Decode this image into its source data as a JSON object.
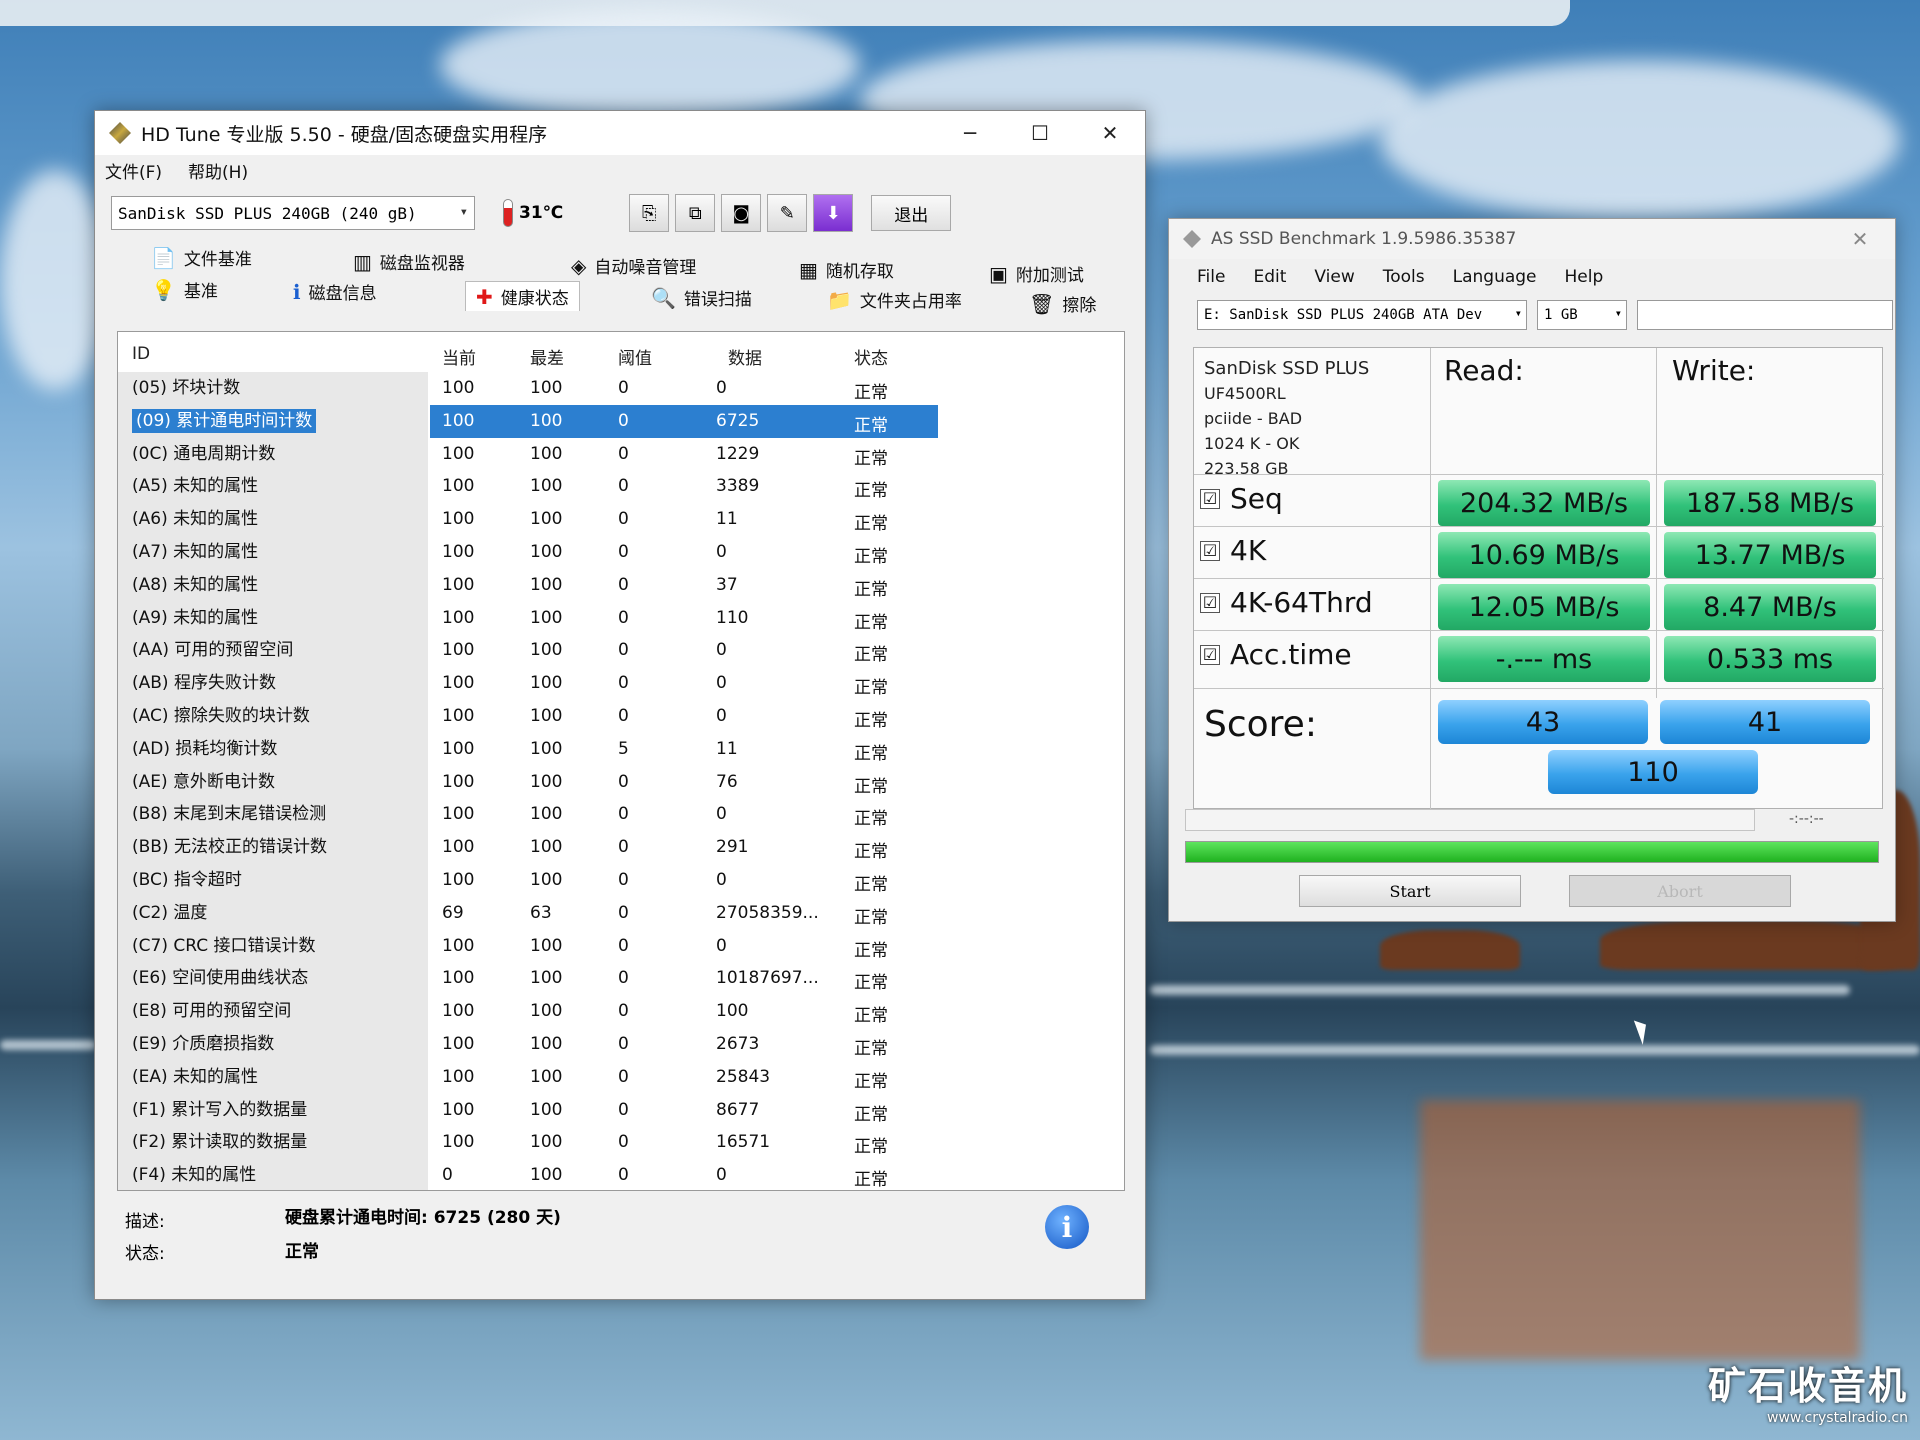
{
  "hdtune": {
    "title": "HD Tune 专业版 5.50 - 硬盘/固态硬盘实用程序",
    "window_controls": [
      "─",
      "☐",
      "✕"
    ],
    "menu": [
      "文件(F)",
      "帮助(H)"
    ],
    "drive": "SanDisk SSD PLUS 240GB (240 gB)",
    "temperature": "31℃",
    "exit_label": "退出",
    "tabs_row1": [
      "文件基准",
      "磁盘监视器",
      "自动噪音管理",
      "随机存取",
      "附加测试"
    ],
    "tabs_row2": [
      "基准",
      "磁盘信息",
      "健康状态",
      "错误扫描",
      "文件夹占用率",
      "擦除"
    ],
    "columns": [
      "ID",
      "当前",
      "最差",
      "阈值",
      "数据",
      "状态"
    ],
    "rows": [
      [
        "(05) 坏块计数",
        "100",
        "100",
        "0",
        "0",
        "正常"
      ],
      [
        "(09) 累计通电时间计数",
        "100",
        "100",
        "0",
        "6725",
        "正常"
      ],
      [
        "(0C) 通电周期计数",
        "100",
        "100",
        "0",
        "1229",
        "正常"
      ],
      [
        "(A5) 未知的属性",
        "100",
        "100",
        "0",
        "3389",
        "正常"
      ],
      [
        "(A6) 未知的属性",
        "100",
        "100",
        "0",
        "11",
        "正常"
      ],
      [
        "(A7) 未知的属性",
        "100",
        "100",
        "0",
        "0",
        "正常"
      ],
      [
        "(A8) 未知的属性",
        "100",
        "100",
        "0",
        "37",
        "正常"
      ],
      [
        "(A9) 未知的属性",
        "100",
        "100",
        "0",
        "110",
        "正常"
      ],
      [
        "(AA) 可用的预留空间",
        "100",
        "100",
        "0",
        "0",
        "正常"
      ],
      [
        "(AB) 程序失败计数",
        "100",
        "100",
        "0",
        "0",
        "正常"
      ],
      [
        "(AC) 擦除失败的块计数",
        "100",
        "100",
        "0",
        "0",
        "正常"
      ],
      [
        "(AD) 损耗均衡计数",
        "100",
        "100",
        "5",
        "11",
        "正常"
      ],
      [
        "(AE) 意外断电计数",
        "100",
        "100",
        "0",
        "76",
        "正常"
      ],
      [
        "(B8) 末尾到末尾错误检测",
        "100",
        "100",
        "0",
        "0",
        "正常"
      ],
      [
        "(BB) 无法校正的错误计数",
        "100",
        "100",
        "0",
        "291",
        "正常"
      ],
      [
        "(BC) 指令超时",
        "100",
        "100",
        "0",
        "0",
        "正常"
      ],
      [
        "(C2) 温度",
        "69",
        "63",
        "0",
        "27058359...",
        "正常"
      ],
      [
        "(C7) CRC 接口错误计数",
        "100",
        "100",
        "0",
        "0",
        "正常"
      ],
      [
        "(E6) 空间使用曲线状态",
        "100",
        "100",
        "0",
        "10187697...",
        "正常"
      ],
      [
        "(E8) 可用的预留空间",
        "100",
        "100",
        "0",
        "100",
        "正常"
      ],
      [
        "(E9) 介质磨损指数",
        "100",
        "100",
        "0",
        "2673",
        "正常"
      ],
      [
        "(EA) 未知的属性",
        "100",
        "100",
        "0",
        "25843",
        "正常"
      ],
      [
        "(F1) 累计写入的数据量",
        "100",
        "100",
        "0",
        "8677",
        "正常"
      ],
      [
        "(F2) 累计读取的数据量",
        "100",
        "100",
        "0",
        "16571",
        "正常"
      ],
      [
        "(F4) 未知的属性",
        "0",
        "100",
        "0",
        "0",
        "正常"
      ]
    ],
    "selected_row": 1,
    "desc_label": "描述:",
    "desc_value": "硬盘累计通电时间: 6725 (280 天)",
    "status_label": "状态:",
    "status_value": "正常",
    "info_glyph": "i"
  },
  "asssd": {
    "title": "AS SSD Benchmark 1.9.5986.35387",
    "close_glyph": "✕",
    "menu": [
      "File",
      "Edit",
      "View",
      "Tools",
      "Language",
      "Help"
    ],
    "drive": "E: SanDisk SSD PLUS 240GB ATA Dev",
    "size": "1 GB",
    "device_info": [
      "SanDisk SSD PLUS",
      "UF4500RL",
      "pciide - BAD",
      "1024 K - OK",
      "223.58 GB"
    ],
    "read_header": "Read:",
    "write_header": "Write:",
    "tests": [
      {
        "label": "Seq",
        "read": "204.32 MB/s",
        "write": "187.58 MB/s"
      },
      {
        "label": "4K",
        "read": "10.69 MB/s",
        "write": "13.77 MB/s"
      },
      {
        "label": "4K-64Thrd",
        "read": "12.05 MB/s",
        "write": "8.47 MB/s"
      },
      {
        "label": "Acc.time",
        "read": "-.--- ms",
        "write": "0.533 ms"
      }
    ],
    "check_glyph": "☑",
    "score_label": "Score:",
    "score_read": "43",
    "score_write": "41",
    "score_total": "110",
    "time_readout": "-:--:--",
    "progress_fraction": 1.0,
    "start_label": "Start",
    "abort_label": "Abort"
  },
  "watermark": {
    "logo_text": "矿石收音机",
    "url": "www.crystalradio.cn"
  }
}
